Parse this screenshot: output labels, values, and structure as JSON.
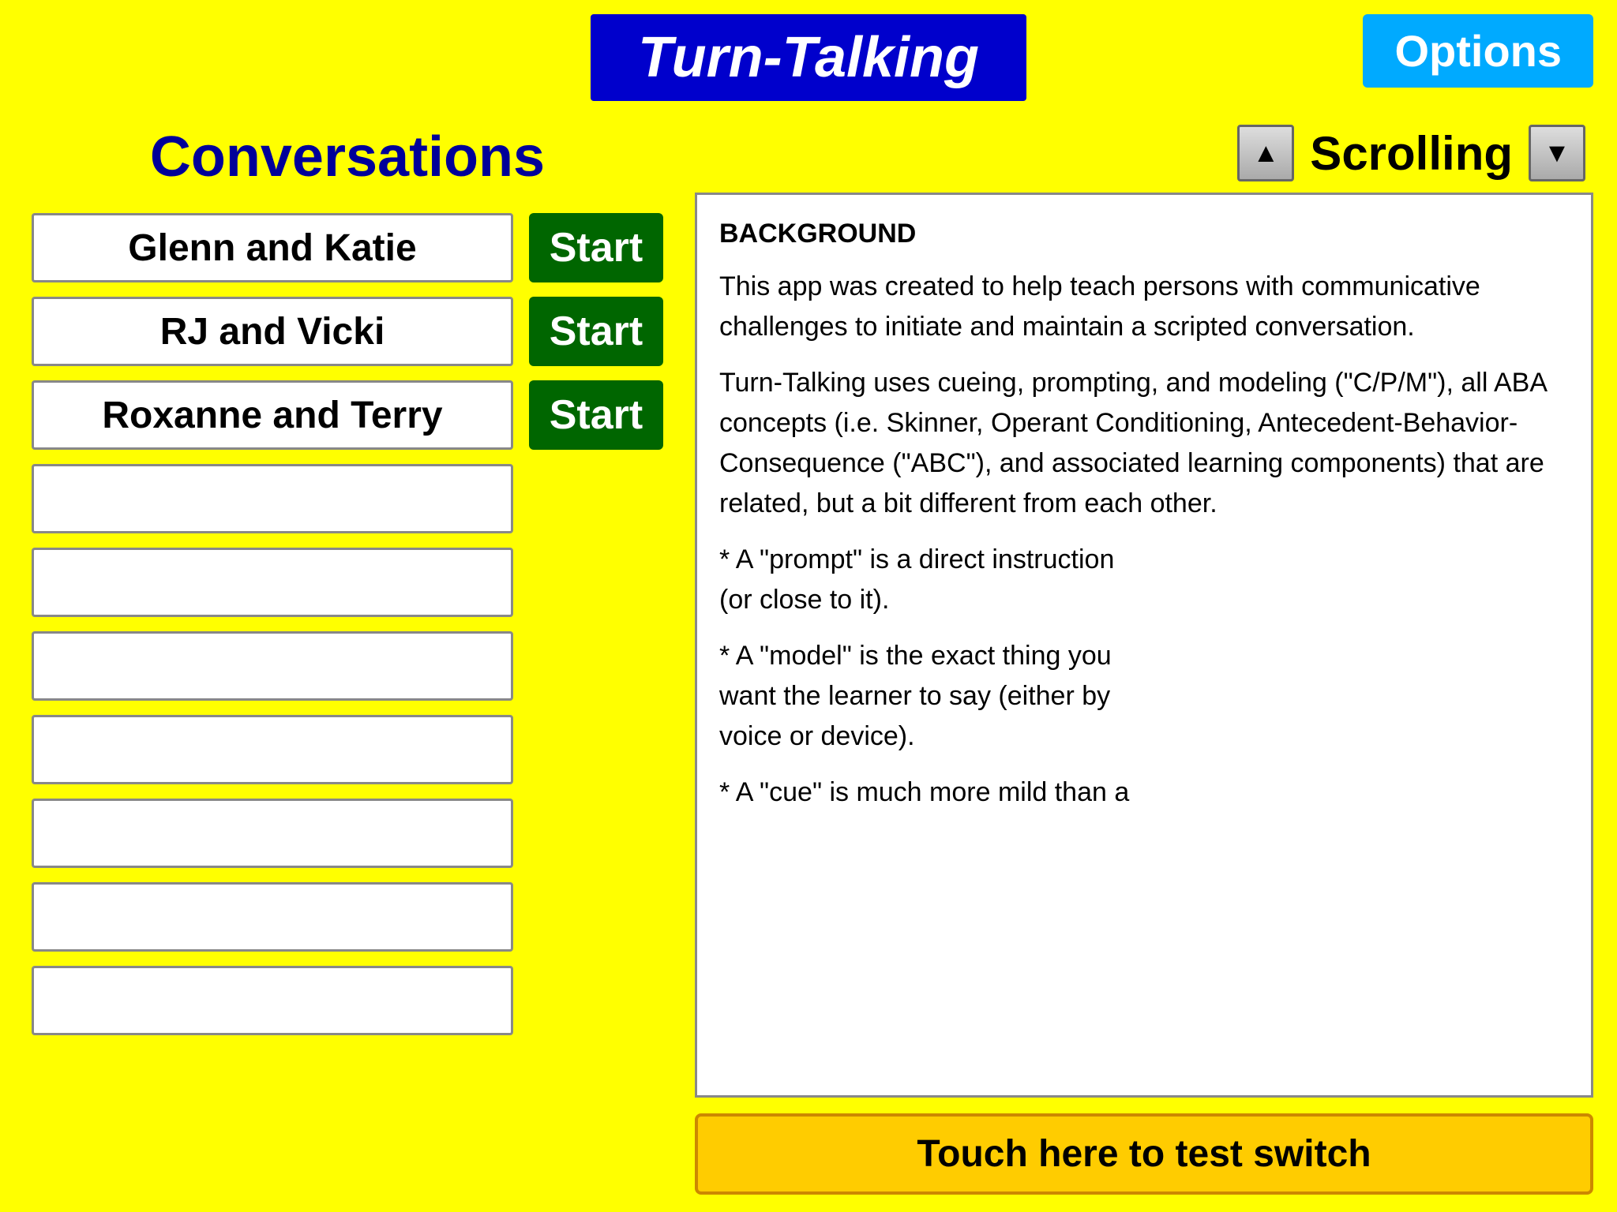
{
  "header": {
    "app_title": "Turn-Talking",
    "options_label": "Options"
  },
  "left_panel": {
    "conversations_title": "Conversations",
    "conversations": [
      {
        "name": "Glenn and Katie",
        "has_start": true
      },
      {
        "name": "RJ and Vicki",
        "has_start": true
      },
      {
        "name": "Roxanne and Terry",
        "has_start": true
      },
      {
        "name": "",
        "has_start": false
      },
      {
        "name": "",
        "has_start": false
      },
      {
        "name": "",
        "has_start": false
      },
      {
        "name": "",
        "has_start": false
      },
      {
        "name": "",
        "has_start": false
      },
      {
        "name": "",
        "has_start": false
      },
      {
        "name": "",
        "has_start": false
      }
    ],
    "start_label": "Start"
  },
  "right_panel": {
    "scroll_title": "Scrolling",
    "content_section_title": "BACKGROUND",
    "content_paragraphs": [
      "   This app was created to help teach persons with communicative challenges to initiate and maintain a scripted conversation.",
      "   Turn-Talking uses cueing, prompting, and modeling (\"C/P/M\"), all ABA concepts (i.e. Skinner, Operant Conditioning, Antecedent-Behavior-Consequence (\"ABC\"), and associated learning components) that are related, but a bit different from each other.",
      "* A \"prompt\" is a direct instruction\n   (or close to it).",
      "* A \"model\" is the exact thing you\n   want the learner to say (either by\n   voice or device).",
      "* A \"cue\" is much more mild than a"
    ],
    "touch_switch_label": "Touch here to test switch"
  }
}
